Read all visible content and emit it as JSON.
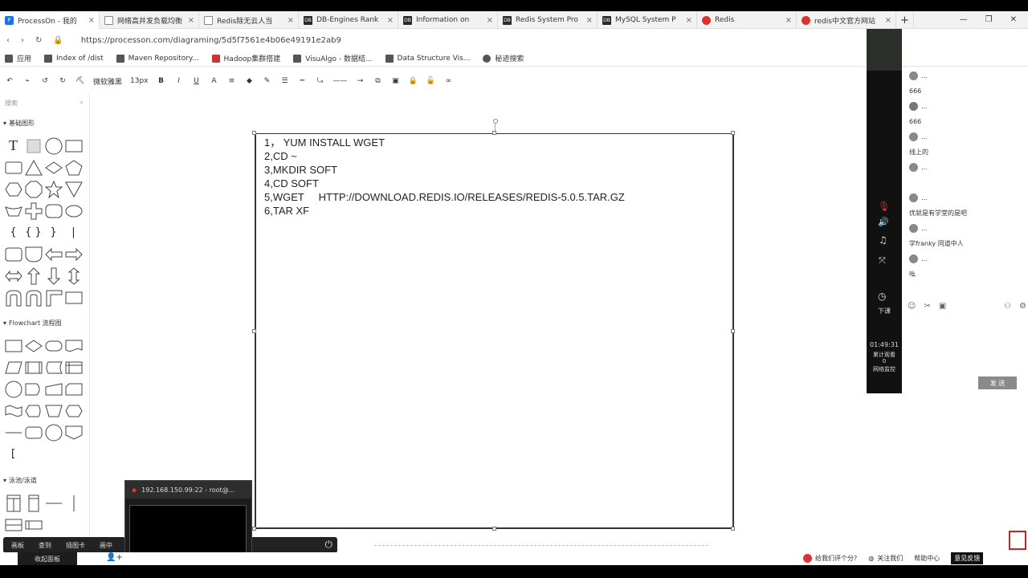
{
  "browser": {
    "tabs": [
      {
        "label": "ProcessOn - 我的",
        "icon": "processon-icon",
        "active": true
      },
      {
        "label": "网络高并发负载均衡",
        "icon": "page-icon"
      },
      {
        "label": "Redis除无云人当",
        "icon": "page-icon"
      },
      {
        "label": "DB-Engines Rank",
        "icon": "db-icon"
      },
      {
        "label": "Information on",
        "icon": "db-icon"
      },
      {
        "label": "Redis System Pro",
        "icon": "db-icon"
      },
      {
        "label": "MySQL System P",
        "icon": "db-icon"
      },
      {
        "label": "Redis",
        "icon": "redis-icon"
      },
      {
        "label": "redis中文官方网站",
        "icon": "redis-icon"
      }
    ],
    "url": "https://processon.com/diagraming/5d5f7561e4b06e49191e2ab9",
    "bookmarks": [
      "应用",
      "Index of /dist",
      "Maven Repository...",
      "Hadoop集群搭建",
      "VisuAlgo - 数据结...",
      "Data Structure Vis...",
      "秘迹搜索"
    ]
  },
  "toolbar": {
    "font": "微软雅黑",
    "size": "13px"
  },
  "sidebar": {
    "search_placeholder": "搜索",
    "sections": [
      "基础图形",
      "Flowchart 流程图",
      "泳池/泳道"
    ]
  },
  "canvas": {
    "lines": [
      "1，  YUM INSTALL WGET",
      "2,CD ~",
      "3,MKDIR SOFT",
      "4,CD SOFT",
      "5,WGET     HTTP://DOWNLOAD.REDIS.IO/RELEASES/REDIS-5.0.5.TAR.GZ",
      "6,TAR XF"
    ]
  },
  "bottom_strip": [
    "画板",
    "查到",
    "插图卡",
    "画中"
  ],
  "left_button": "收起面板",
  "terminal": {
    "title": "192.168.150.99:22 - root@..."
  },
  "live": {
    "time": "01:49:31",
    "label_down": "下课",
    "stats1": "累计观看",
    "stats2": "0",
    "stats3": "网络监控"
  },
  "chat": {
    "messages": [
      {
        "name": "...",
        "text": "666"
      },
      {
        "name": "...",
        "text": "666"
      },
      {
        "name": "...",
        "text": "线上的"
      },
      {
        "name": "...",
        "text": ""
      },
      {
        "name": "...",
        "text": "优就是有学堂的是吧"
      },
      {
        "name": "...",
        "text": "学franky 同道中人"
      },
      {
        "name": "...",
        "text": "吆"
      }
    ],
    "send": "发 送"
  },
  "footer": {
    "rate": "给我们评个分?",
    "follow": "关注我们",
    "help": "帮助中心",
    "feedback": "意见反馈"
  }
}
